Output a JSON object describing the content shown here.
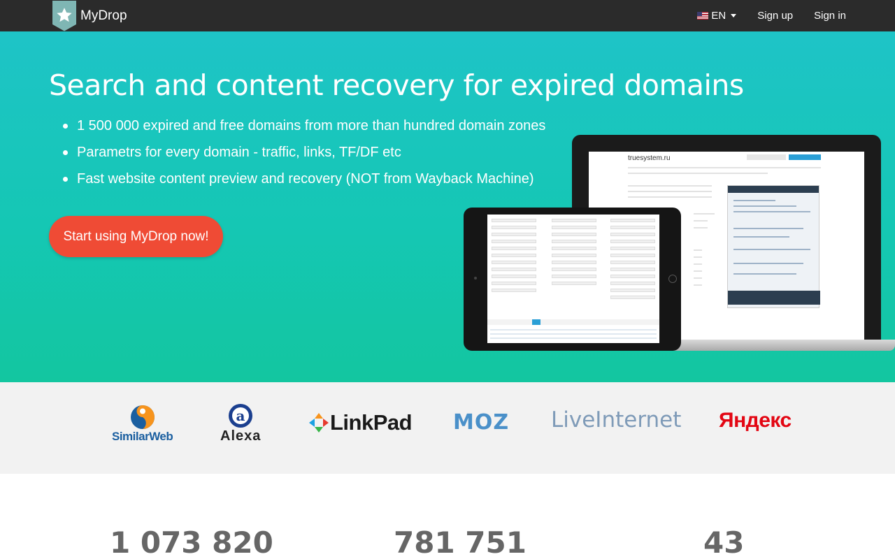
{
  "nav": {
    "brand": "MyDrop",
    "language": "EN",
    "signup": "Sign up",
    "signin": "Sign in"
  },
  "hero": {
    "title": "Search and content recovery for expired domains",
    "bullets": [
      "1 500 000 expired and free domains from more than hundred domain zones",
      "Parametrs for every domain - traffic, links, TF/DF etc",
      "Fast website content preview and recovery (NOT from Wayback Machine)"
    ],
    "cta": "Start using MyDrop now!"
  },
  "mockup": {
    "laptop_title": "truesystem.ru"
  },
  "partners": [
    "SimilarWeb",
    "Alexa",
    "LinkPad",
    "MOZ",
    "LiveInternet",
    "Яндекс"
  ],
  "stats": [
    "1 073 820",
    "781 751",
    "43"
  ],
  "colors": {
    "navbar": "#2b2b2b",
    "hero": "#1ec4c7",
    "cta": "#ef4b35"
  }
}
